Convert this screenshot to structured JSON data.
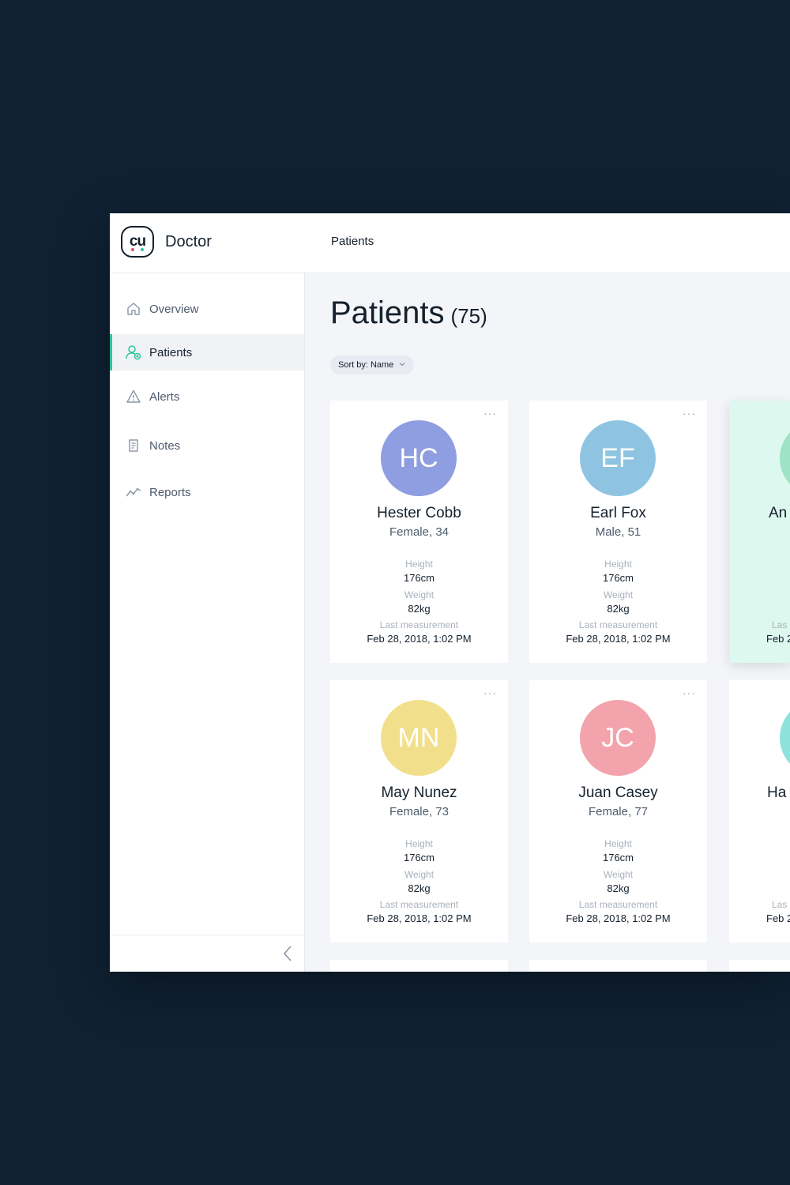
{
  "app": {
    "brand_mark": "cu",
    "brand_name": "Doctor",
    "header_title": "Patients"
  },
  "sidebar": {
    "items": [
      {
        "label": "Overview",
        "icon": "home-icon",
        "active": false
      },
      {
        "label": "Patients",
        "icon": "user-plus-icon",
        "active": true
      },
      {
        "label": "Alerts",
        "icon": "alert-triangle-icon",
        "active": false
      },
      {
        "label": "Notes",
        "icon": "document-icon",
        "active": false
      },
      {
        "label": "Reports",
        "icon": "trend-line-icon",
        "active": false
      }
    ],
    "collapse_icon": "chevron-left-icon"
  },
  "main": {
    "title": "Patients",
    "count": "(75)",
    "sort_label": "Sort by: Name"
  },
  "labels": {
    "height": "Height",
    "weight": "Weight",
    "last_measurement": "Last measurement",
    "more": "···"
  },
  "patients": [
    {
      "initials": "HC",
      "name": "Hester Cobb",
      "meta": "Female, 34",
      "height": "176cm",
      "weight": "82kg",
      "last": "Feb 28, 2018, 1:02 PM",
      "color": "#8f9ee0"
    },
    {
      "initials": "EF",
      "name": "Earl Fox",
      "meta": "Male, 51",
      "height": "176cm",
      "weight": "82kg",
      "last": "Feb 28, 2018, 1:02 PM",
      "color": "#8ec4e2"
    },
    {
      "initials": "",
      "name": "An",
      "meta": "",
      "height": "",
      "weight": "",
      "last_label": "Las",
      "last": "Feb 2",
      "color": "#9fe3c6"
    },
    {
      "initials": "MN",
      "name": "May Nunez",
      "meta": "Female, 73",
      "height": "176cm",
      "weight": "82kg",
      "last": "Feb 28, 2018, 1:02 PM",
      "color": "#f2df8c"
    },
    {
      "initials": "JC",
      "name": "Juan Casey",
      "meta": "Female, 77",
      "height": "176cm",
      "weight": "82kg",
      "last": "Feb 28, 2018, 1:02 PM",
      "color": "#f3a3ac"
    },
    {
      "initials": "",
      "name": "Ha",
      "meta": "",
      "height": "",
      "weight": "",
      "last_label": "Las",
      "last": "Feb 2",
      "color": "#8ee2de"
    }
  ]
}
